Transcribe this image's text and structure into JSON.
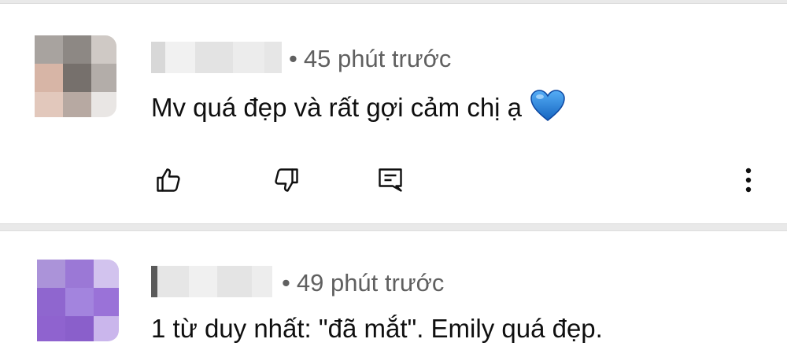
{
  "comments": [
    {
      "time": "45 phút trước",
      "text": "Mv quá đẹp và rất gợi cảm chị ạ",
      "emoji": "blue-heart"
    },
    {
      "time": "49 phút trước",
      "text": "1 từ duy nhất: \"đã mắt\". Emily quá đẹp."
    }
  ],
  "separator": "•",
  "icons": {
    "like": "thumbs-up-icon",
    "dislike": "thumbs-down-icon",
    "reply": "reply-icon",
    "more": "more-vertical-icon"
  },
  "colors": {
    "text": "#0f0f0f",
    "meta": "#606060",
    "heart": "#1e88e5"
  }
}
